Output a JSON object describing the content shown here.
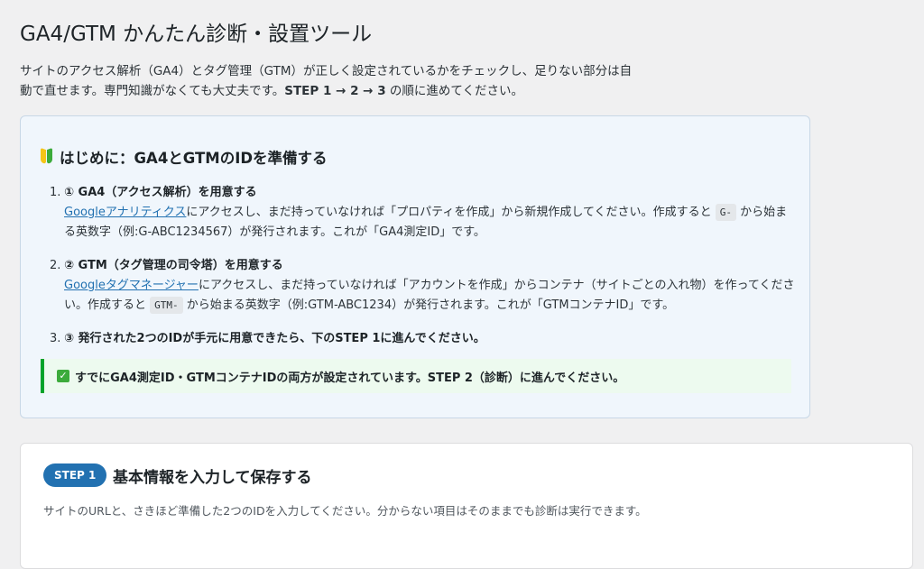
{
  "page": {
    "title": "GA4/GTM かんたん診断・設置ツール",
    "intro_line1": "サイトのアクセス解析（GA4）とタグ管理（GTM）が正しく設定されているかをチェックし、足りない部分は自",
    "intro_line2_a": "動で直せます。専門知識がなくても大丈夫です。",
    "intro_line2_b": "STEP 1 → 2 → 3",
    "intro_line2_c": " の順に進めてください。"
  },
  "prep": {
    "heading": "はじめに：GA4とGTMのIDを準備する",
    "icon": "beginner-mark-icon",
    "steps": [
      {
        "num": "1.",
        "title": "① GA4（アクセス解析）を用意する",
        "link": "Googleアナリティクス",
        "text_a": "にアクセスし、まだ持っていなければ「プロパティを作成」から新規作成してください。作成すると",
        "code": "G-",
        "text_b": "から始まる英数字（例:G-ABC1234567）が発行されます。これが「GA4測定ID」です。"
      },
      {
        "num": "2.",
        "title": "② GTM（タグ管理の司令塔）を用意する",
        "link": "Googleタグマネージャー",
        "text_a": "にアクセスし、まだ持っていなければ「アカウントを作成」からコンテナ（サイトごとの入れ物）を作ってください。作成すると",
        "code": "GTM-",
        "text_b": "から始まる英数字（例:GTM-ABC1234）が発行されます。これが「GTMコンテナID」です。"
      },
      {
        "num": "3.",
        "title": "③ 発行された2つのIDが手元に用意できたら、下のSTEP 1に進んでください。"
      }
    ],
    "notice": "すでにGA4測定ID・GTMコンテナIDの両方が設定されています。STEP 2（診断）に進んでください。",
    "notice_icon": "check-mark-icon"
  },
  "step1": {
    "badge": "STEP 1",
    "heading": "基本情報を入力して保存する",
    "description": "サイトのURLと、さきほど準備した2つのIDを入力してください。分からない項目はそのままでも診断は実行できます。"
  }
}
